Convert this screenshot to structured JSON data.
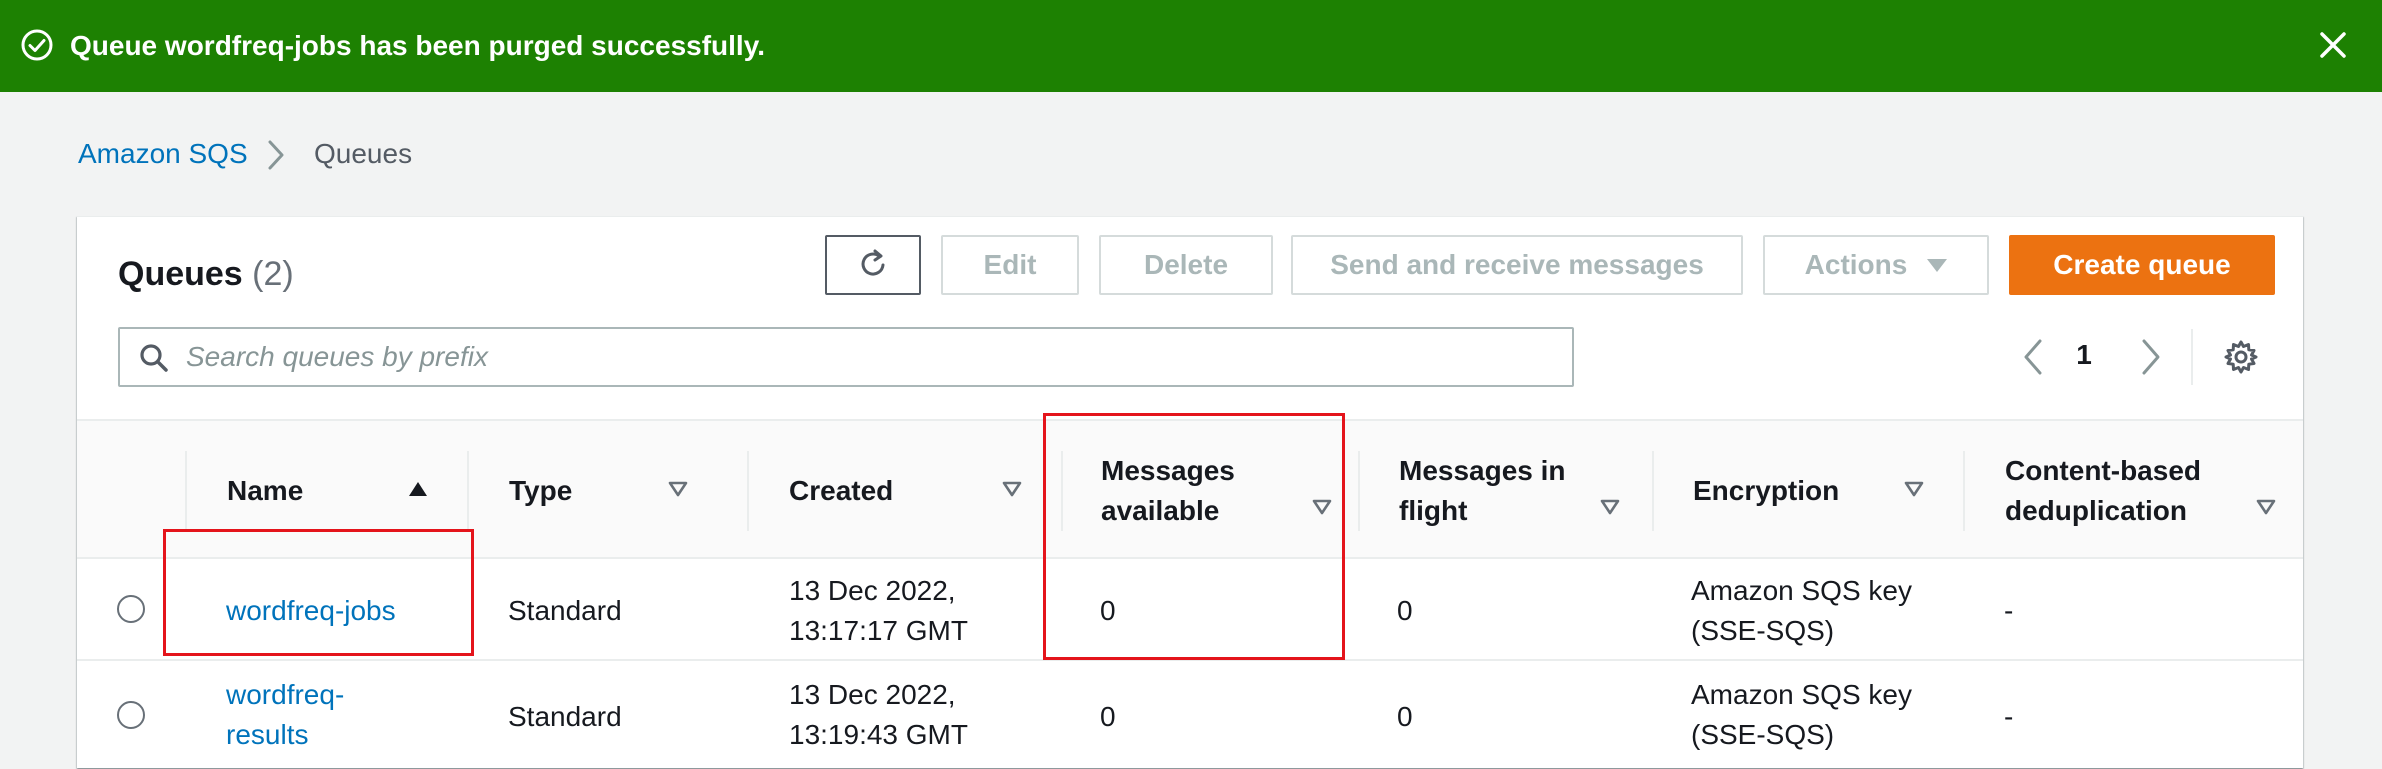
{
  "flash": {
    "message": "Queue wordfreq-jobs has been purged successfully.",
    "status": "success",
    "color": "#1d8102",
    "icon": "check-circle-icon",
    "dismiss_icon": "close-icon"
  },
  "breadcrumb": {
    "home": "Amazon SQS",
    "separator_icon": "chevron-right-icon",
    "current": "Queues"
  },
  "header": {
    "title": "Queues",
    "count": "(2)",
    "refresh_icon": "refresh-icon",
    "buttons": {
      "edit": "Edit",
      "delete": "Delete",
      "send": "Send and receive messages",
      "actions": "Actions",
      "create": "Create queue"
    },
    "create_color": "#ec7211"
  },
  "search": {
    "placeholder": "Search queues by prefix",
    "value": ""
  },
  "pagination": {
    "current_page": "1",
    "prev_icon": "chevron-left-icon",
    "next_icon": "chevron-right-icon",
    "settings_icon": "gear-icon"
  },
  "table": {
    "columns": [
      {
        "label": "Name",
        "sort": "ascending"
      },
      {
        "label": "Type",
        "sort": "none"
      },
      {
        "label": "Created",
        "sort": "none"
      },
      {
        "label": "Messages available",
        "sort": "none"
      },
      {
        "label": "Messages in flight",
        "sort": "none"
      },
      {
        "label": "Encryption",
        "sort": "none"
      },
      {
        "label": "Content-based deduplication",
        "sort": "none"
      }
    ],
    "rows": [
      {
        "name": "wordfreq-jobs",
        "type": "Standard",
        "created": "13 Dec 2022, 13:17:17 GMT",
        "messages_available": "0",
        "messages_in_flight": "0",
        "encryption": "Amazon SQS key (SSE-SQS)",
        "deduplication": "-"
      },
      {
        "name": "wordfreq-results",
        "type": "Standard",
        "created": "13 Dec 2022, 13:19:43 GMT",
        "messages_available": "0",
        "messages_in_flight": "0",
        "encryption": "Amazon SQS key (SSE-SQS)",
        "deduplication": "-"
      }
    ]
  },
  "annotations": {
    "highlight_color": "#e4141b"
  }
}
